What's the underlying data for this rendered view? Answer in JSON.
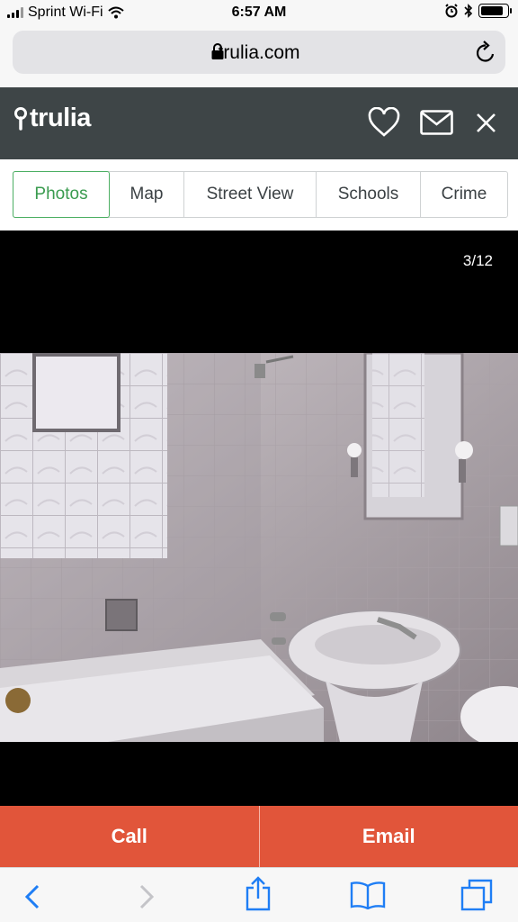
{
  "status_bar": {
    "carrier": "Sprint Wi-Fi",
    "time": "6:57 AM",
    "battery_level": 0.85
  },
  "browser": {
    "url": "trulia.com"
  },
  "header": {
    "logo_text": "trulia"
  },
  "tabs": [
    {
      "label": "Photos",
      "active": true
    },
    {
      "label": "Map",
      "active": false
    },
    {
      "label": "Street View",
      "active": false
    },
    {
      "label": "Schools",
      "active": false
    },
    {
      "label": "Crime",
      "active": false
    }
  ],
  "viewer": {
    "counter": "3/12"
  },
  "actions": {
    "call_label": "Call",
    "email_label": "Email"
  },
  "colors": {
    "brand_green": "#3a9b4f",
    "header_bg": "#3e4547",
    "action_red": "#e1553a"
  },
  "icons": [
    "lock-icon",
    "reload-icon",
    "heart-icon",
    "mail-icon",
    "close-icon",
    "back-icon",
    "forward-icon",
    "share-icon",
    "bookmarks-icon",
    "tabs-icon"
  ]
}
